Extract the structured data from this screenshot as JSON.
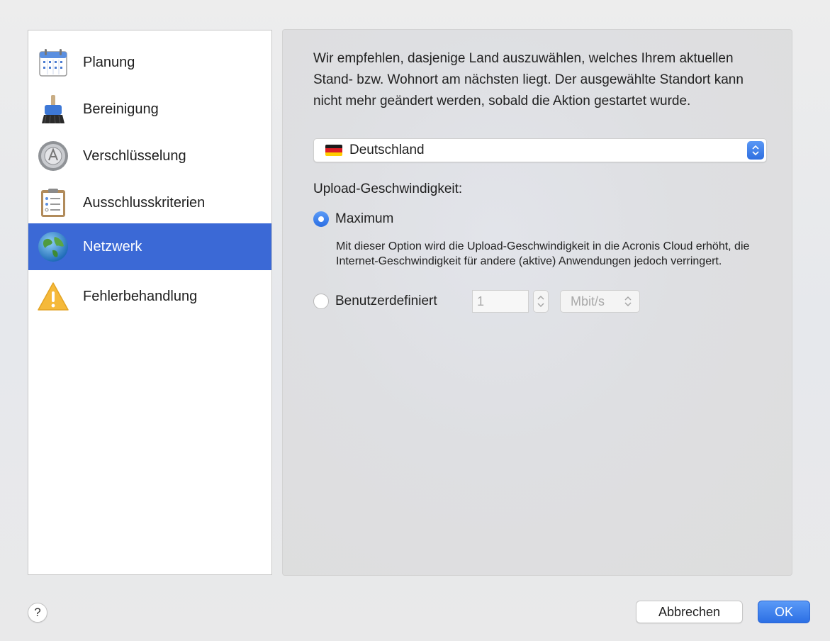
{
  "sidebar": {
    "items": [
      {
        "label": "Planung",
        "icon": "calendar-icon"
      },
      {
        "label": "Bereinigung",
        "icon": "broom-icon"
      },
      {
        "label": "Verschlüsselung",
        "icon": "lock-dial-icon"
      },
      {
        "label": "Ausschlusskriterien",
        "icon": "clipboard-list-icon"
      },
      {
        "label": "Netzwerk",
        "icon": "globe-icon",
        "selected": true
      },
      {
        "label": "Fehlerbehandlung",
        "icon": "warning-icon"
      }
    ]
  },
  "main": {
    "intro": "Wir empfehlen, dasjenige Land auszuwählen, welches Ihrem aktuellen Stand- bzw. Wohnort am nächsten liegt. Der ausgewählte Standort kann nicht mehr geändert werden, sobald die Aktion gestartet wurde.",
    "country": {
      "value": "Deutschland",
      "flag": "germany-flag-icon"
    },
    "upload_label": "Upload-Geschwindigkeit:",
    "options": {
      "maximum": {
        "label": "Maximum",
        "selected": true
      },
      "maximum_desc": "Mit dieser Option wird die Upload-Geschwindigkeit in die Acronis Cloud erhöht, die Internet-Geschwindigkeit für andere (aktive) Anwendungen jedoch verringert.",
      "custom": {
        "label": "Benutzerdefiniert",
        "selected": false,
        "value": "1",
        "unit": "Mbit/s"
      }
    }
  },
  "footer": {
    "help": "?",
    "cancel_label": "Abbrechen",
    "ok_label": "OK"
  },
  "colors": {
    "accent": "#3b69d6",
    "button_blue": "#2c6fe4"
  }
}
